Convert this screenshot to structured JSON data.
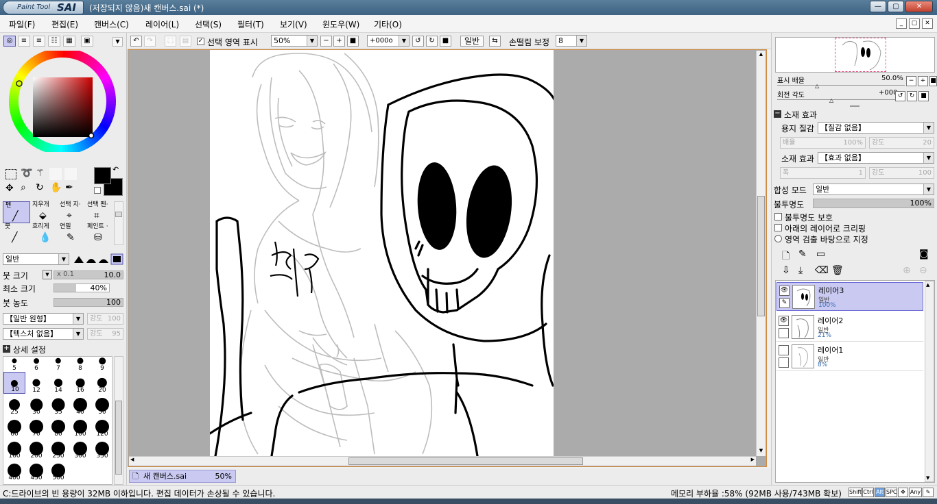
{
  "window": {
    "logo_small": "Paint Tool",
    "logo_big": "SAI",
    "title": "(저장되지 않음)새 캔버스.sai (*)",
    "buttons": {
      "minimize": "—",
      "maximize": "▢",
      "close": "✕"
    }
  },
  "menu": [
    "파일(F)",
    "편집(E)",
    "캔버스(C)",
    "레이어(L)",
    "선택(S)",
    "필터(T)",
    "보기(V)",
    "윈도우(W)",
    "기타(O)"
  ],
  "mdi_buttons": [
    "_",
    "▢",
    "✕"
  ],
  "toolbar": {
    "selection_checkbox_label": "선택 영역 표시",
    "zoom": "50%",
    "rotation": "+000o",
    "mode_button": "일반",
    "stabilizer_label": "손떨림 보정",
    "stabilizer_value": "8"
  },
  "left": {
    "color": {
      "fg": "#000000",
      "bg": "#000000",
      "wheel_hue": "#cc0000"
    },
    "tools": [
      {
        "name": "펜",
        "icon": "pen-icon"
      },
      {
        "name": "지우개",
        "icon": "eraser-icon"
      },
      {
        "name": "선택 지·",
        "icon": "select-pen-icon"
      },
      {
        "name": "선택 펜·",
        "icon": "select-eraser-icon"
      },
      {
        "name": "붓",
        "icon": "brush-icon"
      },
      {
        "name": "흐리게",
        "icon": "blur-icon"
      },
      {
        "name": "연필",
        "icon": "pencil-icon"
      },
      {
        "name": "페인트 ·",
        "icon": "bucket-icon"
      }
    ],
    "blend_mode": "일반",
    "brush_size_label": "붓 크기",
    "brush_size_mult": "x 0.1",
    "brush_size": "10.0",
    "min_size_label": "최소 크기",
    "min_size": "40%",
    "min_size_fraction": 0.4,
    "density_label": "붓 농도",
    "density": "100",
    "shape_dropdown": "【일반 원형】",
    "shape_strength": "강도",
    "shape_strength_val": "100",
    "texture_dropdown": "【텍스처 없음】",
    "texture_strength": "강도",
    "texture_strength_val": "95",
    "detail_label": "상세 설정",
    "brush_sizes": [
      "5",
      "6",
      "7",
      "8",
      "9",
      "10",
      "12",
      "14",
      "16",
      "20",
      "25",
      "30",
      "35",
      "40",
      "50",
      "60",
      "70",
      "80",
      "100",
      "120",
      "160",
      "200",
      "250",
      "300",
      "350",
      "400",
      "450",
      "500"
    ]
  },
  "document_tab": {
    "name": "새 캔버스.sai",
    "zoom": "50%"
  },
  "right": {
    "zoom_label": "표시 배율",
    "zoom_value": "50.0%",
    "rotate_label": "회전 각도",
    "rotate_value": "+000",
    "material_header": "소재 효과",
    "paper_texture_label": "용지 질감",
    "paper_texture_value": "【질감 없음】",
    "ratio_label": "배율",
    "ratio_value": "100%",
    "strength_label": "강도",
    "strength_value": "20",
    "material_effect_label": "소재 효과",
    "material_effect_value": "【효과 없음】",
    "width_label": "폭",
    "width_value": "1",
    "strength2_label": "강도",
    "strength2_value": "100",
    "blend_label": "합성 모드",
    "blend_value": "일반",
    "opacity_label": "불투명도",
    "opacity_value": "100%",
    "protect_opacity": "불투명도 보호",
    "clip_below": "아래의 레이어로 크리핑",
    "selection_source": "영역 검출 바탕으로 지정",
    "layers": [
      {
        "name": "레이어3",
        "mode": "일반",
        "opacity": "100%",
        "selected": true
      },
      {
        "name": "레이어2",
        "mode": "일반",
        "opacity": "21%",
        "selected": false
      },
      {
        "name": "레이어1",
        "mode": "일반",
        "opacity": "8%",
        "selected": false
      }
    ]
  },
  "status": {
    "message": "C:드라이브의 빈 용량이 32MB 이하입니다. 편집 데이터가 손상될 수 있습니다.",
    "memory": "메모리 부하율 :58% (92MB 사용/743MB 확보)",
    "keys": [
      "Shift",
      "Ctrl",
      "Alt",
      "SPC",
      "✥",
      "Any",
      "✎"
    ]
  }
}
